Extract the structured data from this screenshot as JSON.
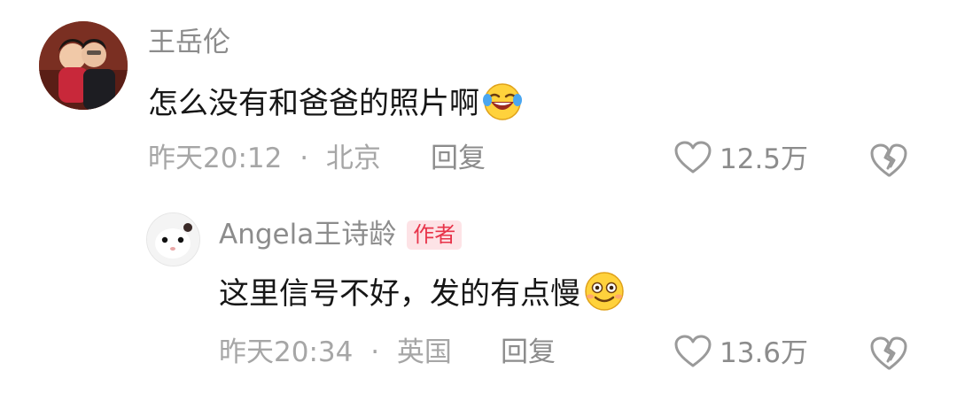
{
  "comment": {
    "author": "王岳伦",
    "text": "怎么没有和爸爸的照片啊",
    "emoji_icon": "rofl-emoji-icon",
    "time": "昨天20:12",
    "separator": "·",
    "location": "北京",
    "reply_label": "回复",
    "likes": "12.5万"
  },
  "reply": {
    "author": "Angela王诗龄",
    "author_badge": "作者",
    "text": "这里信号不好，发的有点慢",
    "emoji_icon": "smile-emoji-icon",
    "time": "昨天20:34",
    "separator": "·",
    "location": "英国",
    "reply_label": "回复",
    "likes": "13.6万"
  },
  "colors": {
    "badge_text": "#e8344a",
    "badge_bg": "#fde3e6",
    "secondary_text": "#8c8c8c"
  }
}
